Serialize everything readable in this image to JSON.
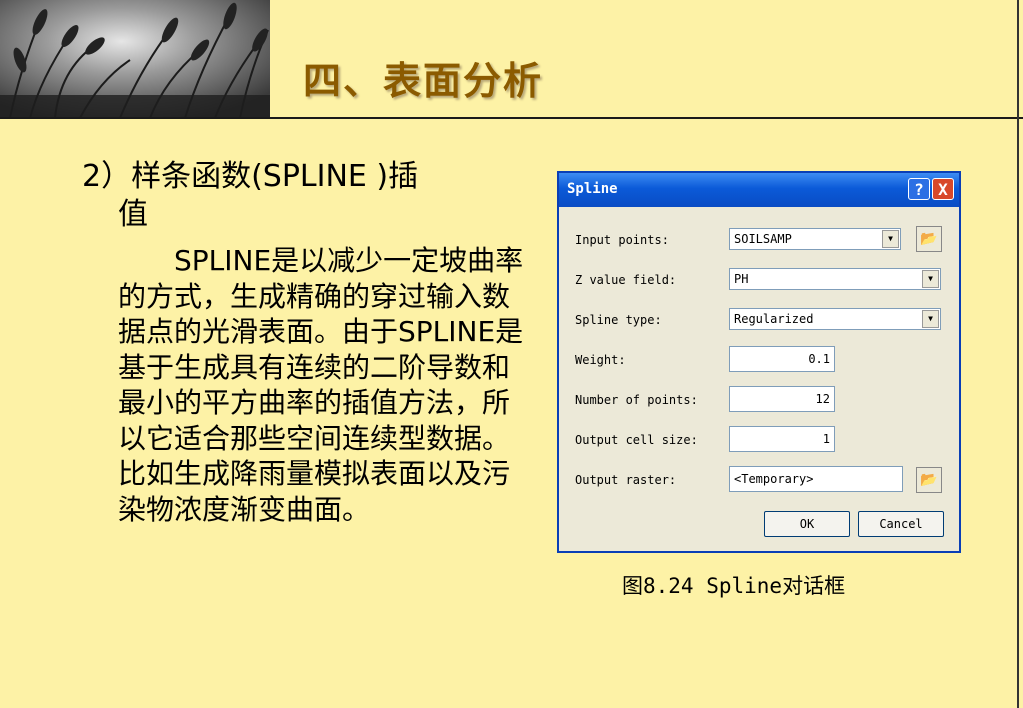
{
  "header": {
    "title": "四、表面分析"
  },
  "content": {
    "heading": "2）样条函数(SPLINE )插",
    "heading_cont": "值",
    "paragraph": "SPLINE是以减少一定坡曲率的方式，生成精确的穿过输入数据点的光滑表面。由于SPLINE是基于生成具有连续的二阶导数和最小的平方曲率的插值方法，所以它适合那些空间连续型数据。比如生成降雨量模拟表面以及污染物浓度渐变曲面。"
  },
  "dialog": {
    "title": "Spline",
    "help": "?",
    "close": "X",
    "labels": {
      "input_points": "Input points:",
      "z_value": "Z value field:",
      "spline_type": "Spline type:",
      "weight": "Weight:",
      "num_points": "Number of points:",
      "cell_size": "Output cell size:",
      "output_raster": "Output raster:"
    },
    "values": {
      "input_points": "SOILSAMP",
      "z_value": "PH",
      "spline_type": "Regularized",
      "weight": "0.1",
      "num_points": "12",
      "cell_size": "1",
      "output_raster": "<Temporary>"
    },
    "ok": "OK",
    "cancel": "Cancel"
  },
  "caption": "图8.24    Spline对话框",
  "colors": {
    "background": "#fdf2a6",
    "title": "#8b5b00",
    "titlebar": "#0b5ad8"
  }
}
